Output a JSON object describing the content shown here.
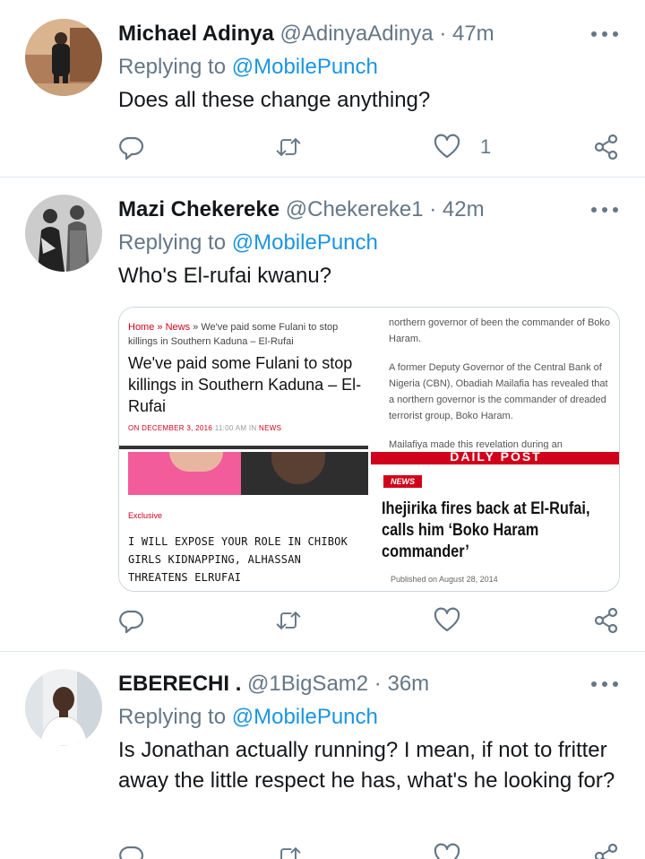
{
  "replying_prefix": "Replying to",
  "tweets": [
    {
      "name": "Michael Adinya",
      "handle": "@AdinyaAdinya",
      "sep": "·",
      "time": "47m",
      "reply_to": "@MobilePunch",
      "text": "Does all these change anything?",
      "likes": "1"
    },
    {
      "name": "Mazi Chekereke",
      "handle": "@Chekereke1",
      "sep": "·",
      "time": "42m",
      "reply_to": "@MobilePunch",
      "text": "Who's El-rufai kwanu?",
      "likes": "",
      "media": {
        "p1": {
          "crumb_home": "Home",
          "crumb_sep1": " » ",
          "crumb_news": "News",
          "crumb_rest": " » We've paid some Fulani to stop killings in Southern Kaduna – El-Rufai",
          "headline": "We've paid some Fulani to stop killings in Southern Kaduna – El-Rufai",
          "meta_date": "ON DECEMBER 3, 2016",
          "meta_time": "11:00 AM",
          "meta_in": "IN",
          "meta_cat": "NEWS"
        },
        "p2": {
          "para1": "northern governor of been the commander of Boko Haram.",
          "para2": "A former Deputy Governor of the Central Bank of Nigeria (CBN), Obadiah Mailafia has revealed that a northern governor is the commander of dreaded terrorist group, Boko Haram.",
          "para3": "Mailafiya made this revelation during an"
        },
        "p3": {
          "tag": "Exclusive",
          "title": "I WILL EXPOSE YOUR ROLE IN CHIBOK GIRLS KIDNAPPING, ALHASSAN THREATENS ELRUFAI"
        },
        "p4": {
          "banner": "DAILY POST",
          "news_label": "NEWS",
          "title": "Ihejirika fires back at El-Rufai, calls him ‘Boko Haram commander’",
          "published": "Published on August 28, 2014"
        }
      }
    },
    {
      "name": "EBERECHI .",
      "handle": "@1BigSam2",
      "sep": "·",
      "time": "36m",
      "reply_to": "@MobilePunch",
      "text": "Is Jonathan actually running? I mean, if not to fritter away the little respect he has, what's he looking for?",
      "likes": ""
    }
  ],
  "icons": {
    "reply": "reply-icon",
    "retweet": "retweet-icon",
    "like": "heart-icon",
    "share": "share-icon",
    "more": "more-icon"
  },
  "colors": {
    "link": "#1b95e0",
    "secondary": "#657786",
    "primary": "#14171a",
    "divider": "#e1e8ed",
    "accent_red": "#d0021b"
  }
}
